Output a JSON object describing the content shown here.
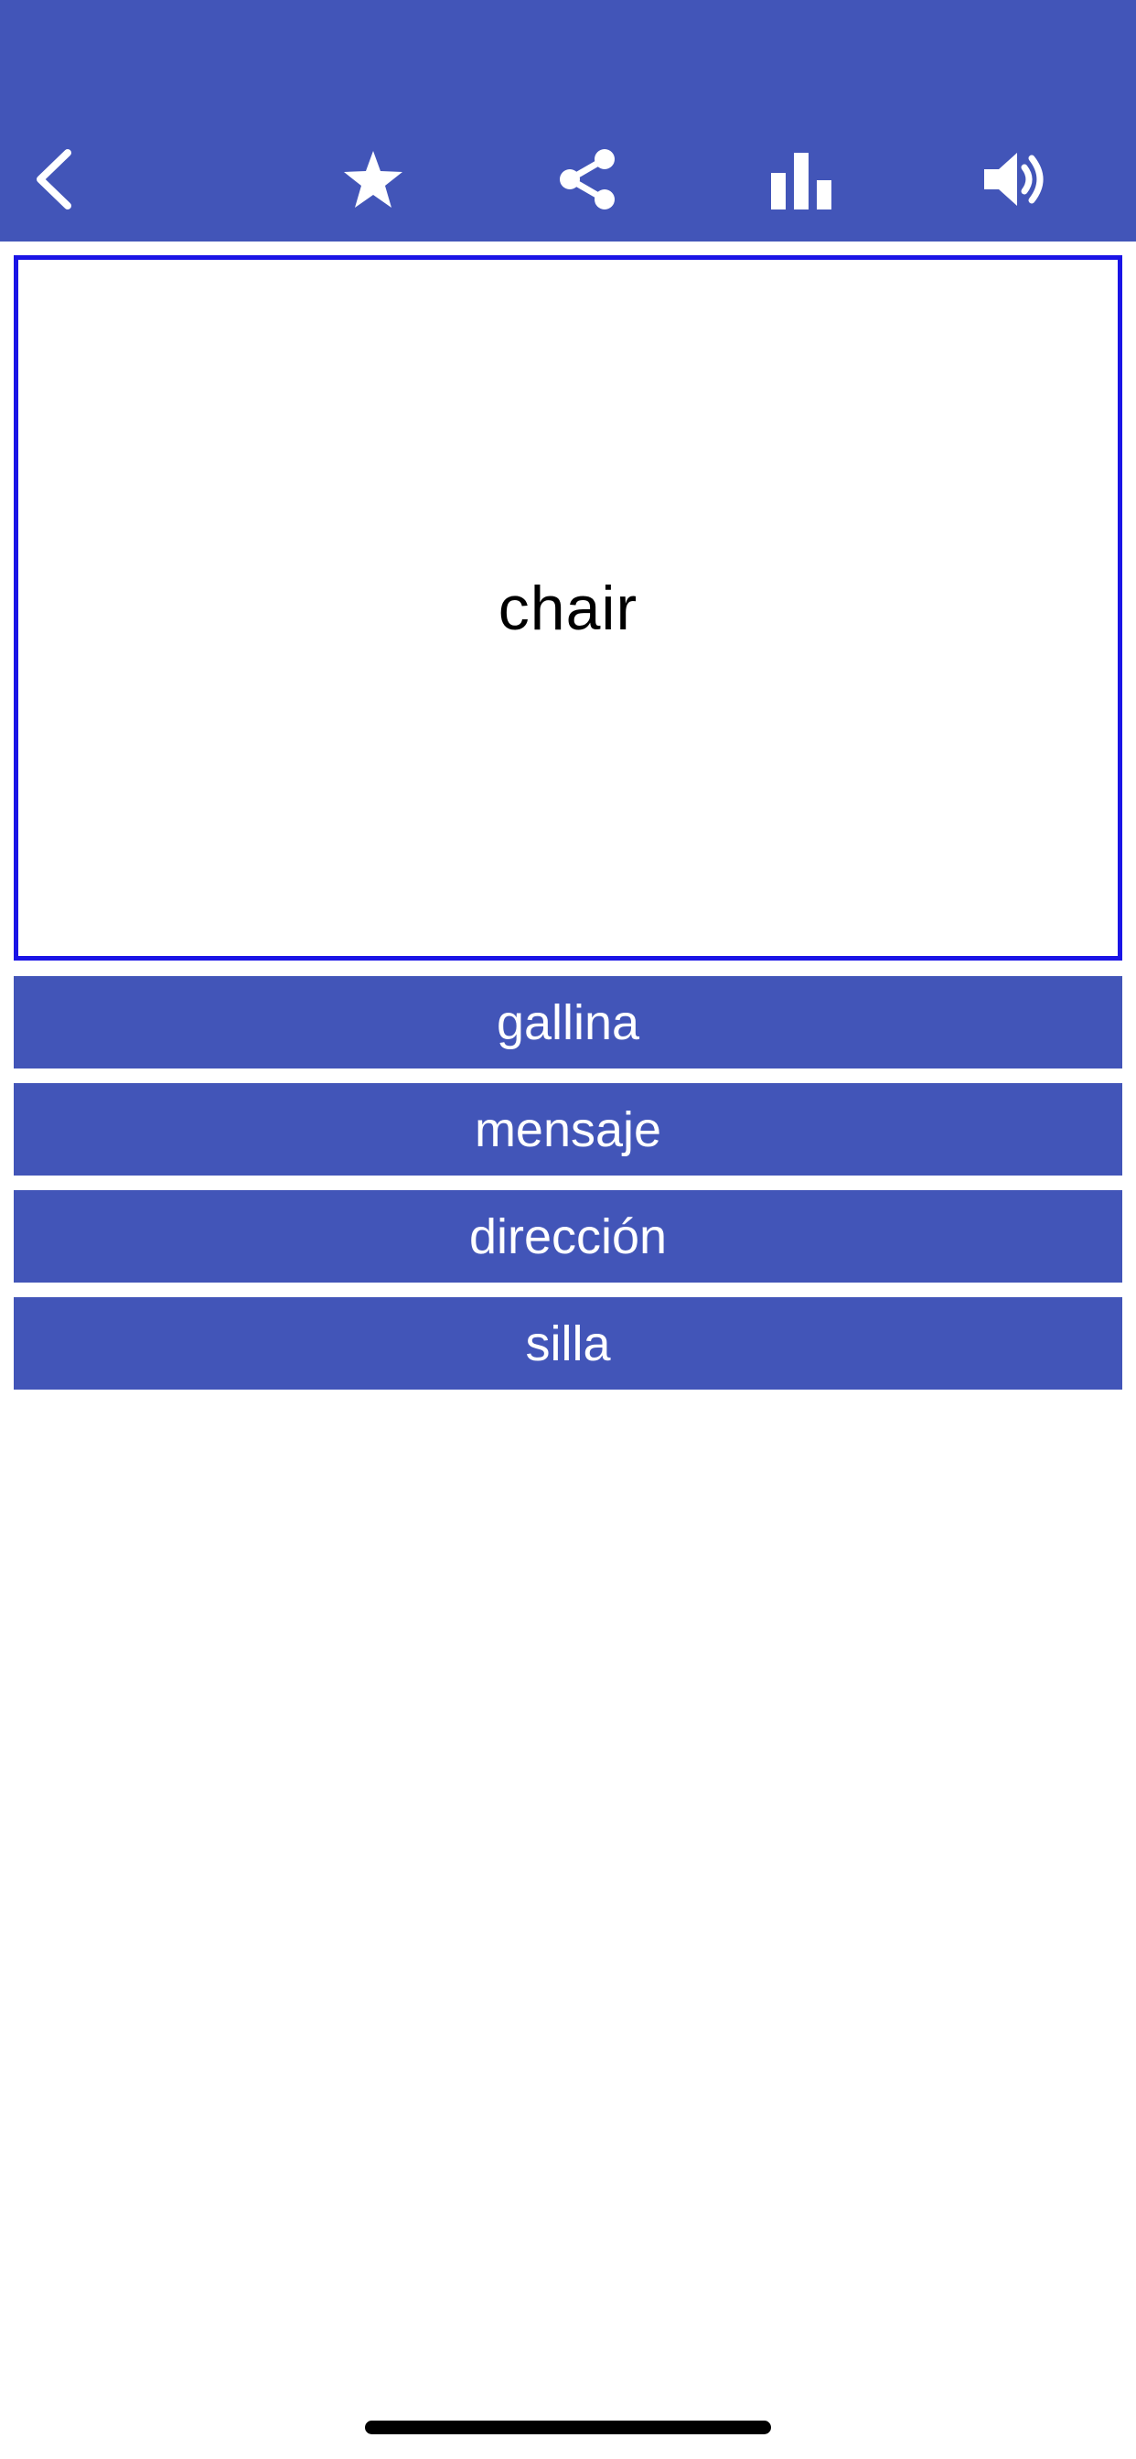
{
  "toolbar": {
    "background_color": "#4255b8",
    "icons": [
      "back-chevron-icon",
      "star-icon",
      "share-icon",
      "bar-chart-icon",
      "speaker-icon"
    ]
  },
  "flashcard": {
    "word": "chair",
    "border_color": "#1a14e6"
  },
  "answers": [
    {
      "label": "gallina"
    },
    {
      "label": "mensaje"
    },
    {
      "label": "dirección"
    },
    {
      "label": "silla"
    }
  ],
  "colors": {
    "accent": "#4255b8",
    "text_on_accent": "#ffffff"
  }
}
